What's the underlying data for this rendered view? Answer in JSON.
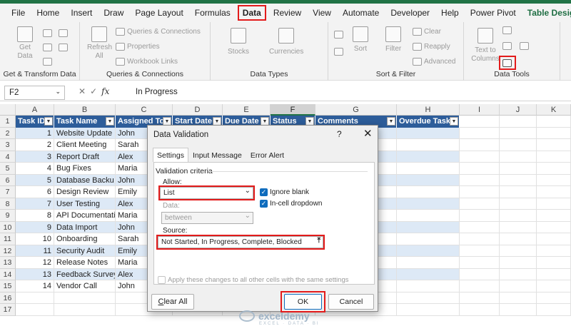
{
  "ribbon_tabs": [
    "File",
    "Home",
    "Insert",
    "Draw",
    "Page Layout",
    "Formulas",
    "Data",
    "Review",
    "View",
    "Automate",
    "Developer",
    "Help",
    "Power Pivot",
    "Table Design"
  ],
  "active_tab": "Data",
  "ribbon": {
    "get_data": {
      "label": "Get Data",
      "arrow": "⌄",
      "group": "Get & Transform Data"
    },
    "queries": {
      "refresh": "Refresh All",
      "queries_connections": "Queries & Connections",
      "properties": "Properties",
      "workbook_links": "Workbook Links",
      "group": "Queries & Connections"
    },
    "data_types": {
      "stocks": "Stocks",
      "currencies": "Currencies",
      "group": "Data Types"
    },
    "sort_filter": {
      "sort": "Sort",
      "filter": "Filter",
      "clear": "Clear",
      "reapply": "Reapply",
      "advanced": "Advanced",
      "group": "Sort & Filter"
    },
    "data_tools": {
      "text_to_columns": "Text to Columns",
      "group": "Data Tools"
    }
  },
  "formula_bar": {
    "name_box": "F2",
    "fx": "fx",
    "value": "In Progress"
  },
  "columns": [
    "A",
    "B",
    "C",
    "D",
    "E",
    "F",
    "G",
    "H",
    "I",
    "J",
    "K"
  ],
  "row_numbers": [
    "1",
    "2",
    "3",
    "4",
    "5",
    "6",
    "7",
    "8",
    "9",
    "10",
    "11",
    "12",
    "13",
    "14",
    "15",
    "16",
    "17"
  ],
  "table": {
    "headers": [
      "Task ID",
      "Task Name",
      "Assigned To",
      "Start Date",
      "Due Date",
      "Status",
      "Comments",
      "Overdue Task"
    ],
    "rows": [
      {
        "id": "1",
        "name": "Website Update",
        "assigned": "John",
        "comment": ""
      },
      {
        "id": "2",
        "name": "Client Meeting",
        "assigned": "Sarah",
        "comment": "dy"
      },
      {
        "id": "3",
        "name": "Report Draft",
        "assigned": "Alex",
        "comment": ""
      },
      {
        "id": "4",
        "name": "Bug Fixes",
        "assigned": "Maria",
        "comment": "s"
      },
      {
        "id": "5",
        "name": "Database Backu",
        "assigned": "John",
        "comment": ""
      },
      {
        "id": "6",
        "name": "Design Review",
        "assigned": "Emily",
        "comment": ""
      },
      {
        "id": "7",
        "name": "User Testing",
        "assigned": "Alex",
        "comment": "g"
      },
      {
        "id": "8",
        "name": "API Documentati",
        "assigned": "Maria",
        "comment": ""
      },
      {
        "id": "9",
        "name": "Data Import",
        "assigned": "John",
        "comment": "es"
      },
      {
        "id": "10",
        "name": "Onboarding",
        "assigned": "Sarah",
        "comment": "ent"
      },
      {
        "id": "11",
        "name": "Security Audit",
        "assigned": "Emily",
        "comment": ""
      },
      {
        "id": "12",
        "name": "Release Notes",
        "assigned": "Maria",
        "comment": "hed"
      },
      {
        "id": "13",
        "name": "Feedback Survey",
        "assigned": "Alex",
        "comment": ""
      },
      {
        "id": "14",
        "name": "Vendor Call",
        "assigned": "John",
        "comment": ""
      }
    ]
  },
  "dialog": {
    "title": "Data Validation",
    "help": "?",
    "close": "✕",
    "tabs": [
      "Settings",
      "Input Message",
      "Error Alert"
    ],
    "criteria_label": "Validation criteria",
    "allow_label": "Allow:",
    "allow_value": "List",
    "data_label": "Data:",
    "data_value": "between",
    "ignore_blank": "Ignore blank",
    "in_cell_dropdown": "In-cell dropdown",
    "source_label": "Source:",
    "source_value": "Not Started, In Progress, Complete, Blocked",
    "apply_all": "Apply these changes to all other cells with the same settings",
    "clear_all": "Clear All",
    "ok": "OK",
    "cancel": "Cancel"
  },
  "watermark": {
    "name": "exceldemy",
    "tagline": "EXCEL · DATA · BI"
  },
  "colors": {
    "excel_green": "#217346",
    "table_header": "#2d5d9a",
    "band": "#dde9f6",
    "highlight": "#e31b1b"
  }
}
